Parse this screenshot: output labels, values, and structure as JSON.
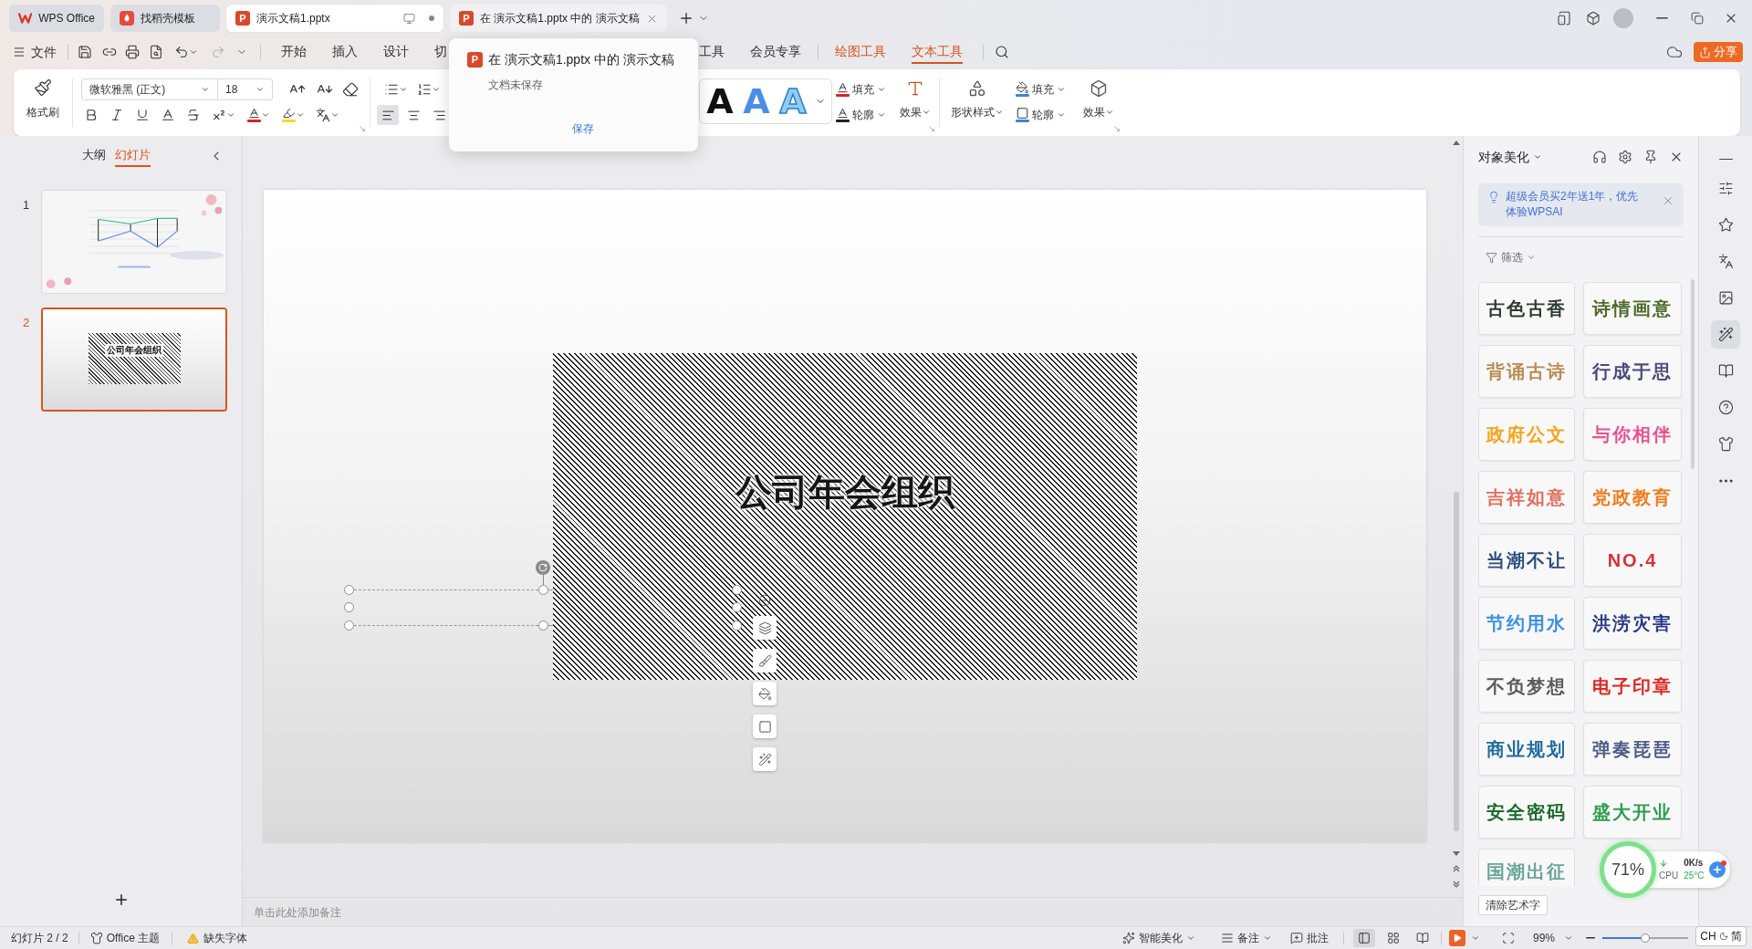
{
  "title_bar": {
    "tabs": [
      {
        "kind": "home",
        "label": "WPS Office",
        "selected": false
      },
      {
        "kind": "template",
        "label": "找稻壳模板",
        "selected": false
      },
      {
        "kind": "document",
        "badge": "P",
        "label": "演示文稿1.pptx",
        "selected": true
      },
      {
        "kind": "document",
        "badge": "P",
        "label": "在 演示文稿1.pptx 中的 演示文稿",
        "selected": false
      }
    ]
  },
  "menu": {
    "file": "文件",
    "tab_groups": [
      [
        {
          "label": "开始",
          "selected": false,
          "contextual": false
        },
        {
          "label": "插入",
          "selected": false,
          "contextual": false
        },
        {
          "label": "设计",
          "selected": false,
          "contextual": false
        },
        {
          "label": "切",
          "selected": false,
          "contextual": false
        }
      ],
      [
        {
          "label": "工具",
          "selected": false,
          "contextual": false
        },
        {
          "label": "会员专享",
          "selected": false,
          "contextual": false
        }
      ],
      [
        {
          "label": "绘图工具",
          "selected": false,
          "contextual": true
        },
        {
          "label": "文本工具",
          "selected": true,
          "contextual": true
        }
      ]
    ],
    "share": "分享"
  },
  "popup": {
    "badge": "P",
    "title": "在 演示文稿1.pptx 中的 演示文稿",
    "status": "文档未保存",
    "action": "保存"
  },
  "ribbon": {
    "format_painter": "格式刷",
    "font_family": "微软雅黑 (正文)",
    "font_size": "18",
    "alignment": [
      {
        "kind": "left",
        "selected": true
      },
      {
        "kind": "center",
        "selected": false
      },
      {
        "kind": "right",
        "selected": false
      }
    ],
    "wordart_presets": [
      {
        "kind": "solid",
        "letter": "A",
        "color": "#111111"
      },
      {
        "kind": "solid",
        "letter": "A",
        "color": "#4a8ee6"
      },
      {
        "kind": "outline",
        "letter": "A",
        "color": "#8fcdf2"
      }
    ],
    "text_fill": "填充",
    "text_outline": "轮廓",
    "text_effect": "效果",
    "shape_style": "形状样式",
    "shape_fill": "填充",
    "shape_outline": "轮廓",
    "shape_effect": "效果"
  },
  "slides_panel": {
    "tabs": [
      {
        "label": "大纲",
        "selected": false
      },
      {
        "label": "幻灯片",
        "selected": true
      }
    ],
    "slides": [
      {
        "number": "1",
        "kind": "chart",
        "selected": false
      },
      {
        "number": "2",
        "kind": "title",
        "title": "公司年会组织",
        "selected": true
      }
    ]
  },
  "slide": {
    "title": "公司年会组织"
  },
  "notes": {
    "placeholder": "单击此处添加备注"
  },
  "beautify_panel": {
    "title": "对象美化",
    "promo": "超级会员买2年送1年，优先体验WPSAI",
    "filter": "筛选",
    "styles": [
      {
        "label": "古色古香",
        "color": "#2d3b33"
      },
      {
        "label": "诗情画意",
        "color": "#4d6a2a"
      },
      {
        "label": "背诵古诗",
        "color": "#b98b52"
      },
      {
        "label": "行成于思",
        "color": "#4b4b80"
      },
      {
        "label": "政府公文",
        "color": "#f5a417"
      },
      {
        "label": "与你相伴",
        "color": "#ea5290"
      },
      {
        "label": "吉祥如意",
        "color": "#e36d5c"
      },
      {
        "label": "党政教育",
        "color": "#ee7d1a"
      },
      {
        "label": "当潮不让",
        "color": "#2d4f80"
      },
      {
        "label": "NO.4",
        "color": "#d93036"
      },
      {
        "label": "节约用水",
        "color": "#3b8fe6"
      },
      {
        "label": "洪涝灾害",
        "color": "#283b87"
      },
      {
        "label": "不负梦想",
        "color": "#5a5a5a"
      },
      {
        "label": "电子印章",
        "color": "#e0281e"
      },
      {
        "label": "商业规划",
        "color": "#1f6c9c"
      },
      {
        "label": "弹奏琵琶",
        "color": "#4d5c86"
      },
      {
        "label": "安全密码",
        "color": "#1d6a2d"
      },
      {
        "label": "盛大开业",
        "color": "#2f9c4d"
      },
      {
        "label": "国潮出征",
        "color": "#6aa596"
      }
    ],
    "clear_button": "清除艺术字"
  },
  "tool_strip": [
    {
      "kind": "collapse",
      "selected": false
    },
    {
      "kind": "adjust",
      "selected": false
    },
    {
      "kind": "favorite",
      "selected": false
    },
    {
      "kind": "translate",
      "selected": false
    },
    {
      "kind": "image",
      "selected": false
    },
    {
      "kind": "beautify",
      "selected": true
    },
    {
      "kind": "read",
      "selected": false
    },
    {
      "kind": "help",
      "selected": false
    },
    {
      "kind": "skin",
      "selected": false
    },
    {
      "kind": "more",
      "selected": false
    }
  ],
  "status_bar": {
    "slide_counter": "幻灯片 2 / 2",
    "theme": "Office 主题",
    "missing_fonts": "缺失字体",
    "beautify": "智能美化",
    "notes": "备注",
    "comments": "批注",
    "views": [
      {
        "kind": "normal",
        "selected": true
      },
      {
        "kind": "sorter",
        "selected": false
      },
      {
        "kind": "reading",
        "selected": false
      }
    ],
    "zoom": "99%",
    "zoom_slider": {
      "level": 0.5
    }
  },
  "system_monitor": {
    "percent": "71%",
    "net_speed": "0K/s",
    "cpu_label": "CPU",
    "cpu_temp": "25°C"
  },
  "input_method": {
    "language": "CH",
    "mode": "简"
  }
}
